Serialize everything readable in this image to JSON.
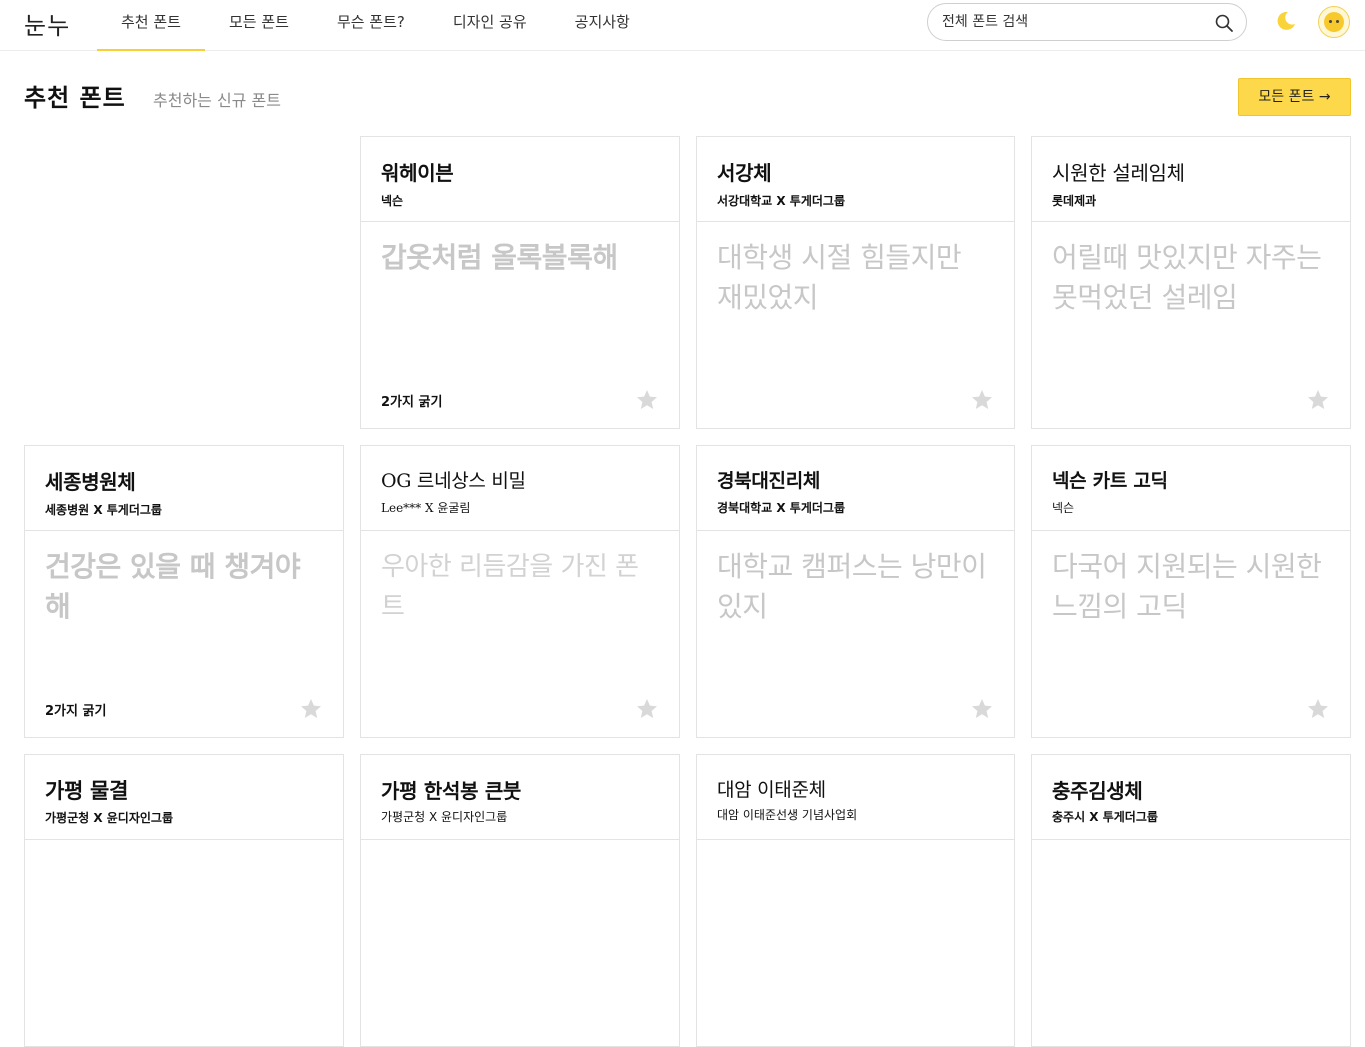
{
  "header": {
    "logo": "눈누",
    "nav": [
      {
        "label": "추천 폰트",
        "active": true
      },
      {
        "label": "모든 폰트",
        "active": false
      },
      {
        "label": "무슨 폰트?",
        "active": false
      },
      {
        "label": "디자인 공유",
        "active": false
      },
      {
        "label": "공지사항",
        "active": false
      }
    ],
    "search_placeholder": "전체 폰트 검색",
    "icons": [
      "search-icon",
      "moon-icon",
      "avatar"
    ]
  },
  "section": {
    "title": "추천 폰트",
    "subtitle": "추천하는 신규 폰트",
    "all_button": "모든 폰트 →"
  },
  "colors": {
    "accent": "#fcd84a",
    "star": "#d9d9d9",
    "sample_text": "#c7c7c7"
  },
  "cards": [
    {
      "name": "워헤이븐",
      "author": "넥슨",
      "sample": "갑옷처럼 올록볼록해",
      "weights": "2가지 굵기"
    },
    {
      "name": "서강체",
      "author": "서강대학교 X 투게더그룹",
      "sample": "대학생 시절 힘들지만 재밌었지",
      "weights": ""
    },
    {
      "name": "시원한 설레임체",
      "author": "롯데제과",
      "sample": "어릴때 맛있지만 자주는 못먹었던 설레임",
      "weights": ""
    },
    {
      "name": "세종병원체",
      "author": "세종병원 X 투게더그룹",
      "sample": "건강은 있을 때 챙겨야해",
      "weights": "2가지 굵기"
    },
    {
      "name": "OG 르네상스 비밀",
      "author": "Lee*** X 윤굴림",
      "sample": "우아한 리듬감을 가진 폰트",
      "weights": ""
    },
    {
      "name": "경북대진리체",
      "author": "경북대학교 X 투게더그룹",
      "sample": "대학교 캠퍼스는 낭만이 있지",
      "weights": ""
    },
    {
      "name": "넥슨 카트 고딕",
      "author": "넥슨",
      "sample": "다국어 지원되는 시원한 느낌의 고딕",
      "weights": ""
    },
    {
      "name": "가평 물결",
      "author": "가평군청 X 윤디자인그룹",
      "sample": "",
      "weights": ""
    },
    {
      "name": "가평 한석봉 큰붓",
      "author": "가평군청 X 윤디자인그룹",
      "sample": "",
      "weights": ""
    },
    {
      "name": "대암 이태준체",
      "author": "대암 이태준선생 기념사업회",
      "sample": "",
      "weights": ""
    },
    {
      "name": "충주김생체",
      "author": "충주시 X 투게더그룹",
      "sample": "",
      "weights": ""
    }
  ]
}
